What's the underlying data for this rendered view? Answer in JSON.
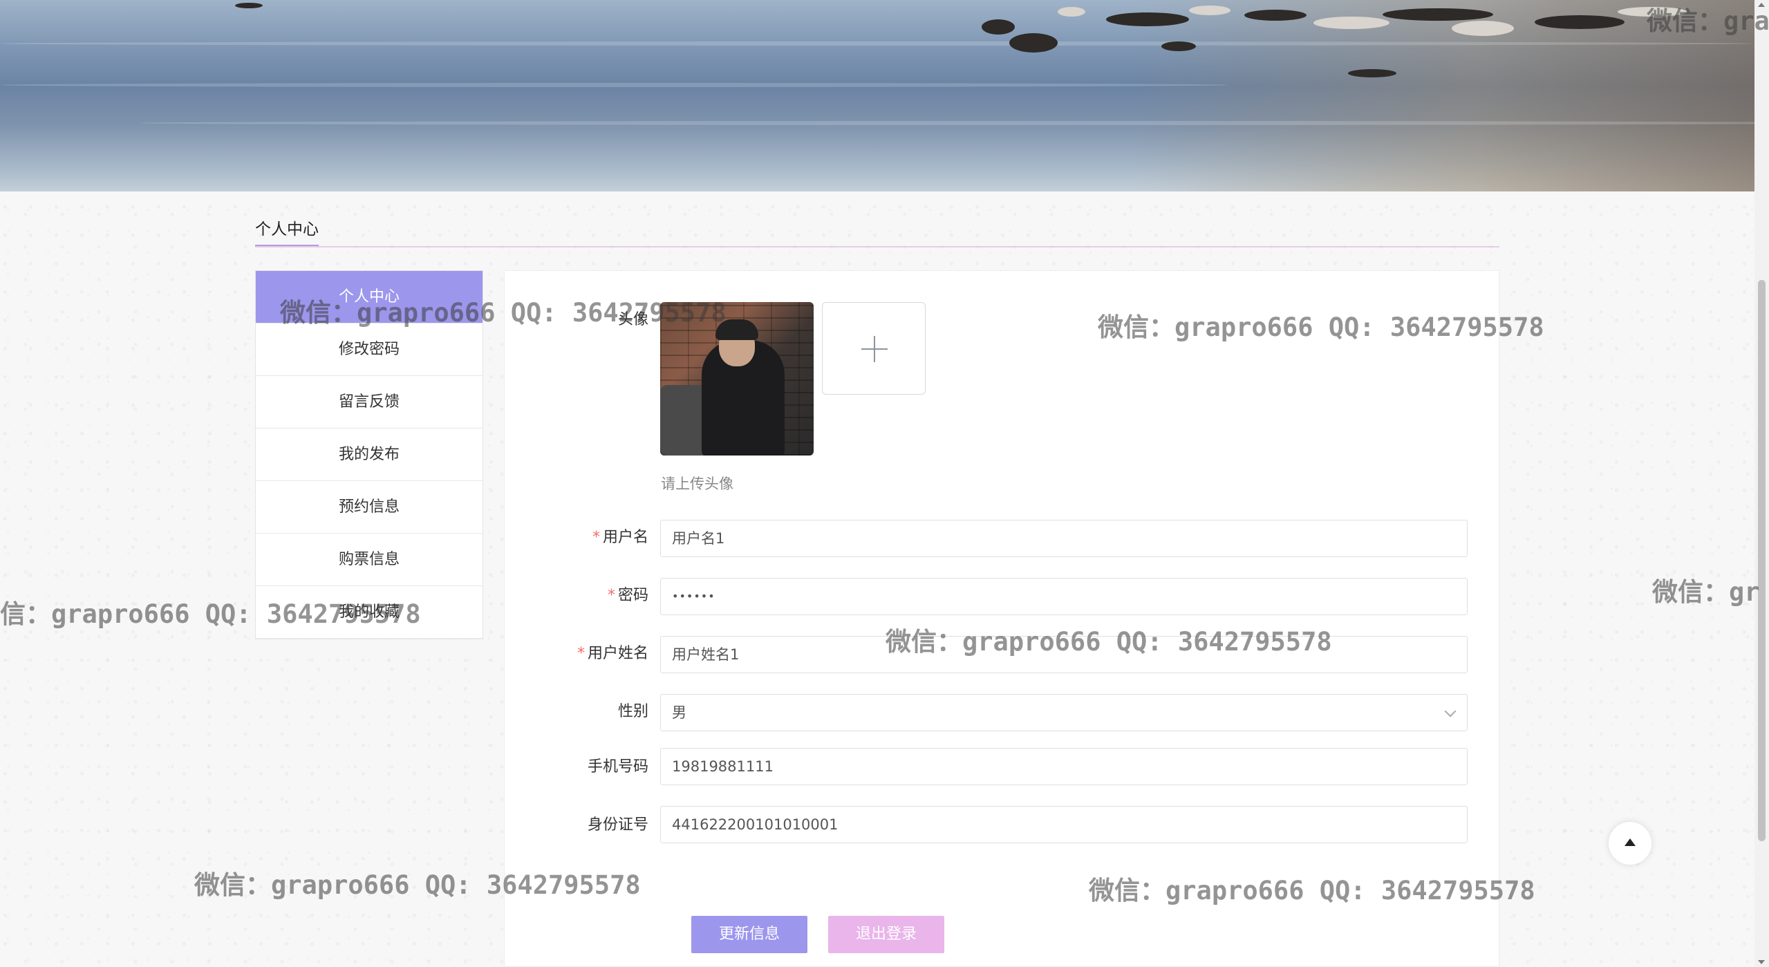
{
  "page": {
    "section_title": "个人中心"
  },
  "menu": {
    "items": [
      {
        "label": "个人中心",
        "active": true
      },
      {
        "label": "修改密码",
        "active": false
      },
      {
        "label": "留言反馈",
        "active": false
      },
      {
        "label": "我的发布",
        "active": false
      },
      {
        "label": "预约信息",
        "active": false
      },
      {
        "label": "购票信息",
        "active": false
      },
      {
        "label": "我的收藏",
        "active": false
      }
    ]
  },
  "form": {
    "avatar_label": "头像",
    "avatar_hint": "请上传头像",
    "fields": [
      {
        "label": "用户名",
        "required": true,
        "value": "用户名1"
      },
      {
        "label": "密码",
        "required": true,
        "value": "••••••"
      },
      {
        "label": "用户姓名",
        "required": true,
        "value": "用户姓名1"
      },
      {
        "label": "性别",
        "required": false,
        "value": "男"
      },
      {
        "label": "手机号码",
        "required": false,
        "value": "19819881111"
      },
      {
        "label": "身份证号",
        "required": false,
        "value": "441622200101010001"
      }
    ],
    "required_mark": "*"
  },
  "buttons": {
    "update": "更新信息",
    "logout": "退出登录"
  },
  "watermark": {
    "text": "微信：grapro666 QQ: 3642795578",
    "cut_left": "信：grapro666 QQ: 3642795578",
    "cut_right_1": "微信：gra",
    "cut_right_2": "微信：gr"
  },
  "colors": {
    "accent": "#9c96ec",
    "logout": "#e9b5ea",
    "required": "#f56c6c"
  },
  "icons": {
    "upload": "plus-icon",
    "back_top": "arrow-up-icon",
    "select": "chevron-down-icon"
  }
}
